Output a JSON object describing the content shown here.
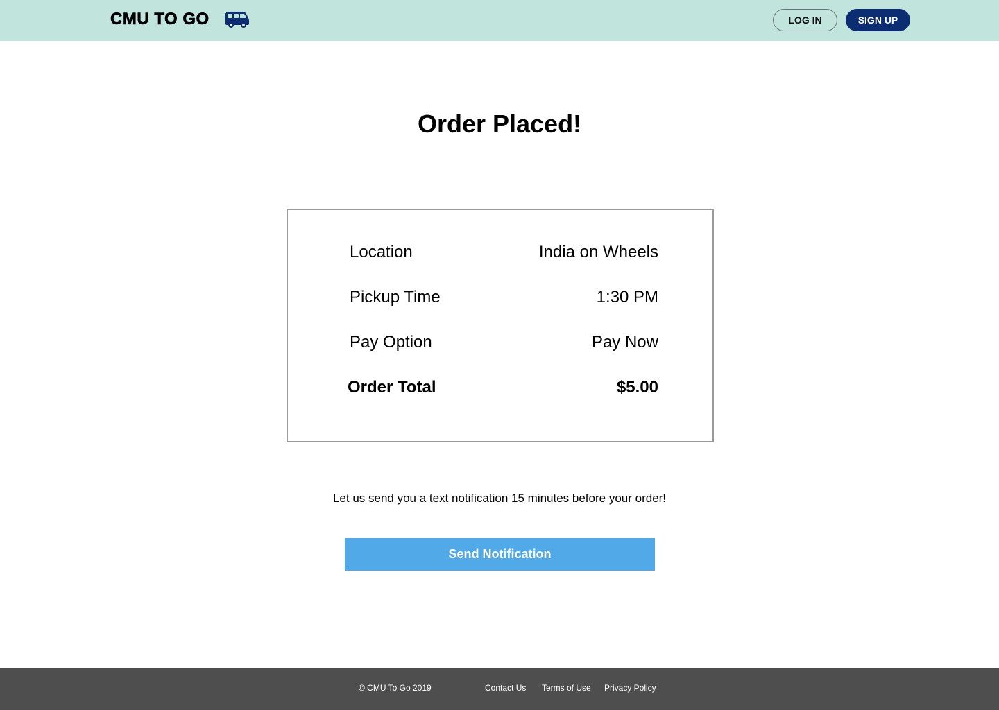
{
  "header": {
    "logo_text": "CMU TO GO",
    "logo_icon": "van-icon",
    "login_label": "LOG IN",
    "signup_label": "SIGN UP",
    "colors": {
      "header_bg": "#c1e4dd",
      "brand": "#0d2d72"
    }
  },
  "main": {
    "title": "Order Placed!",
    "summary": {
      "location_label": "Location",
      "location_value": "India on Wheels",
      "pickup_label": "Pickup Time",
      "pickup_value": "1:30 PM",
      "pay_label": "Pay Option",
      "pay_value": "Pay Now",
      "total_label": "Order Total",
      "total_value": "$5.00"
    },
    "notification_text": "Let us send you a text notification 15 minutes before your order!",
    "notify_button_label": "Send Notification",
    "notify_button_color": "#52a9e8"
  },
  "footer": {
    "copyright": "© CMU To Go 2019",
    "links": {
      "contact": "Contact Us",
      "terms": "Terms of Use",
      "privacy": "Privacy Policy"
    },
    "bg_color": "#4e4e4f"
  }
}
